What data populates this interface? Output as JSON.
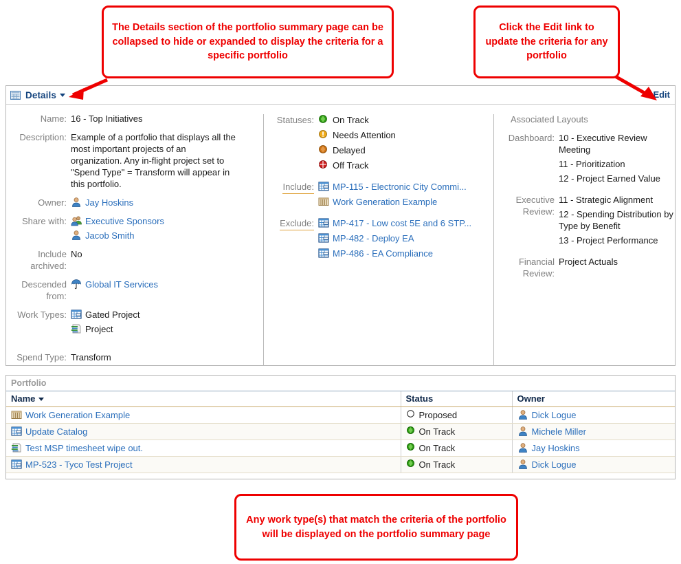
{
  "callouts": {
    "details": "The Details section of the portfolio summary page can be collapsed to hide or expanded to display the criteria for a specific portfolio",
    "edit": "Click the Edit link to update the criteria for any portfolio",
    "bottom": "Any work type(s) that match the criteria of the portfolio will be displayed on the portfolio summary page"
  },
  "details_panel": {
    "title": "Details",
    "edit_link": "Edit",
    "left": {
      "name_label": "Name:",
      "name_value": "16 - Top Initiatives",
      "description_label": "Description:",
      "description_value": "Example of a portfolio that displays all the most important projects of an organization. Any in-flight project set to \"Spend Type\" = Transform will appear in this portfolio.",
      "owner_label": "Owner:",
      "owner_value": "Jay Hoskins",
      "share_label": "Share with:",
      "share_values": [
        "Executive Sponsors",
        "Jacob Smith"
      ],
      "include_archived_label": "Include archived:",
      "include_archived_value": "No",
      "descended_label": "Descended from:",
      "descended_value": "Global IT Services",
      "work_types_label": "Work Types:",
      "work_types_values": [
        "Gated Project",
        "Project"
      ],
      "spend_type_label": "Spend Type:",
      "spend_type_value": "Transform"
    },
    "middle": {
      "statuses_label": "Statuses:",
      "statuses": [
        {
          "label": "On Track",
          "color": "#36a800"
        },
        {
          "label": "Needs Attention",
          "color": "#e8a200"
        },
        {
          "label": "Delayed",
          "color": "#d97706"
        },
        {
          "label": "Off Track",
          "color": "#d91a1a"
        }
      ],
      "include_label": "Include:",
      "include_items": [
        {
          "label": "MP-115 - Electronic City Commi...",
          "icon": "gated-project-icon"
        },
        {
          "label": "Work Generation Example",
          "icon": "portfolio-icon"
        }
      ],
      "exclude_label": "Exclude:",
      "exclude_items": [
        {
          "label": "MP-417 - Low cost 5E and 6 STP...",
          "icon": "gated-project-icon"
        },
        {
          "label": "MP-482 - Deploy EA",
          "icon": "gated-project-icon"
        },
        {
          "label": "MP-486 - EA Compliance",
          "icon": "gated-project-icon"
        }
      ]
    },
    "right": {
      "section_title": "Associated Layouts",
      "dashboard_label": "Dashboard:",
      "dashboard_values": [
        "10 - Executive Review Meeting",
        "11 - Prioritization",
        "12 - Project Earned Value"
      ],
      "executive_review_label": "Executive Review:",
      "executive_review_values": [
        "11 - Strategic Alignment",
        "12 - Spending Distribution by Type by Benefit",
        "13 - Project Performance"
      ],
      "financial_review_label": "Financial Review:",
      "financial_review_values": [
        "Project Actuals"
      ]
    }
  },
  "portfolio_grid": {
    "caption": "Portfolio",
    "columns": [
      "Name",
      "Status",
      "Owner"
    ],
    "rows": [
      {
        "name": "Work Generation Example",
        "name_icon": "portfolio-icon",
        "status": "Proposed",
        "status_color": "#ffffff",
        "owner": "Dick Logue"
      },
      {
        "name": "Update Catalog",
        "name_icon": "gated-project-icon",
        "status": "On Track",
        "status_color": "#36a800",
        "owner": "Michele Miller"
      },
      {
        "name": "Test MSP timesheet wipe out.",
        "name_icon": "project-icon",
        "status": "On Track",
        "status_color": "#36a800",
        "owner": "Jay Hoskins"
      },
      {
        "name": "MP-523 - Tyco Test Project",
        "name_icon": "gated-project-icon",
        "status": "On Track",
        "status_color": "#36a800",
        "owner": "Dick Logue"
      }
    ]
  },
  "colors": {
    "callout_red": "#ee0000",
    "link_blue": "#2a6ebb",
    "header_blue": "#14447e"
  }
}
